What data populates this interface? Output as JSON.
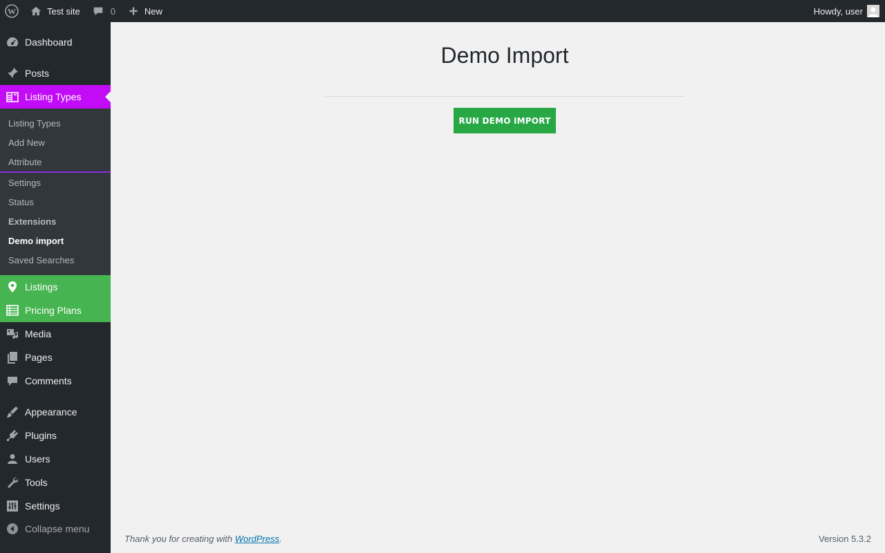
{
  "adminbar": {
    "site_name": "Test site",
    "comments_count": "0",
    "new_label": "New",
    "howdy": "Howdy, user"
  },
  "sidebar": {
    "menu": {
      "dashboard": "Dashboard",
      "posts": "Posts",
      "listing_types": "Listing Types",
      "listings": "Listings",
      "pricing_plans": "Pricing Plans",
      "media": "Media",
      "pages": "Pages",
      "comments": "Comments",
      "appearance": "Appearance",
      "plugins": "Plugins",
      "users": "Users",
      "tools": "Tools",
      "settings": "Settings",
      "collapse": "Collapse menu"
    },
    "submenu": {
      "listing_types": "Listing Types",
      "add_new": "Add New",
      "attribute": "Attribute",
      "settings": "Settings",
      "status": "Status",
      "extensions": "Extensions",
      "demo_import": "Demo import",
      "saved_searches": "Saved Searches"
    }
  },
  "main": {
    "title": "Demo Import",
    "run_button": "RUN DEMO IMPORT"
  },
  "footer": {
    "thanks_prefix": "Thank you for creating with ",
    "wp_link": "WordPress",
    "thanks_suffix": ".",
    "version": "Version 5.3.2"
  },
  "colors": {
    "accent_purple": "#c20cf7",
    "accent_green": "#46b450",
    "button_green": "#28a745"
  }
}
